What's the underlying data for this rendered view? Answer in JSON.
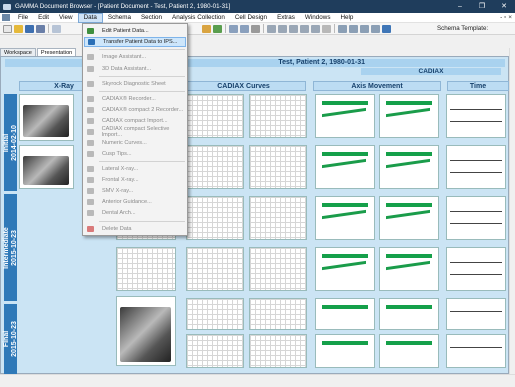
{
  "window": {
    "title": "GAMMA Document Browser - [Patient Document - Test, Patient 2, 1980-01-31]",
    "controls": [
      "–",
      "❐",
      "✕"
    ]
  },
  "menubar": {
    "items": [
      "File",
      "Edit",
      "View",
      "Data",
      "Schema",
      "Section",
      "Analysis Collection",
      "Cell Design",
      "Extras",
      "Windows",
      "Help"
    ],
    "right_controls": "- ▫ ×"
  },
  "toolbar": {
    "schema_label": "Schema Template:"
  },
  "tabs": [
    "Workspace",
    "Presentation"
  ],
  "document": {
    "patient_title": "Test, Patient 2, 1980-01-31",
    "cadiax_label": "CADIAX",
    "columns": [
      "X-Ray",
      "CADIAX Curves",
      "Axis Movement",
      "Time"
    ],
    "rows": [
      {
        "label": "Initial",
        "date": "2014-02-10"
      },
      {
        "label": "Intermediate",
        "date": "2015-10-23"
      },
      {
        "label": "Final",
        "date": "2015-10-23"
      }
    ]
  },
  "data_menu": {
    "items": [
      {
        "label": "Edit Patient Data...",
        "enabled": true,
        "color": "#3f8f3f"
      },
      {
        "label": "Transfer Patient Data to IPS...",
        "enabled": true,
        "highlighted": true,
        "color": "#2a6fb6"
      },
      {
        "label": "Image Assistant...",
        "enabled": false,
        "color": "#9a9a9a"
      },
      {
        "label": "3D Data Assistant...",
        "enabled": false,
        "color": "#9a9a9a"
      },
      {
        "label": "Skyrock Diagnostic Sheet",
        "enabled": false,
        "color": "#9a9a9a"
      },
      {
        "label": "CADIAX® Recorder...",
        "enabled": false,
        "color": "#9a9a9a"
      },
      {
        "label": "CADIAX® compact 2 Recorder...",
        "enabled": false,
        "color": "#9a9a9a"
      },
      {
        "label": "CADIAX compact Import...",
        "enabled": false,
        "color": "#9a9a9a"
      },
      {
        "label": "CADIAX compact Selective Import...",
        "enabled": false,
        "color": "#9a9a9a"
      },
      {
        "label": "Numeric Curves...",
        "enabled": false,
        "color": "#9a9a9a"
      },
      {
        "label": "Cusp Tips...",
        "enabled": false,
        "color": "#9a9a9a"
      },
      {
        "label": "Lateral X-ray...",
        "enabled": false,
        "color": "#9a9a9a"
      },
      {
        "label": "Frontal X-ray...",
        "enabled": false,
        "color": "#9a9a9a"
      },
      {
        "label": "SMV X-ray...",
        "enabled": false,
        "color": "#9a9a9a"
      },
      {
        "label": "Anterior Guidance...",
        "enabled": false,
        "color": "#9a9a9a"
      },
      {
        "label": "Dental Arch...",
        "enabled": false,
        "color": "#9a9a9a"
      },
      {
        "label": "Delete Data",
        "enabled": false,
        "color": "#d97a7a"
      }
    ]
  },
  "colors": {
    "title_bar": "#1f3d5c",
    "row_header": "#2f79b8",
    "doc_background": "#cbe4f4",
    "menu_highlight": "#cde6fb"
  }
}
